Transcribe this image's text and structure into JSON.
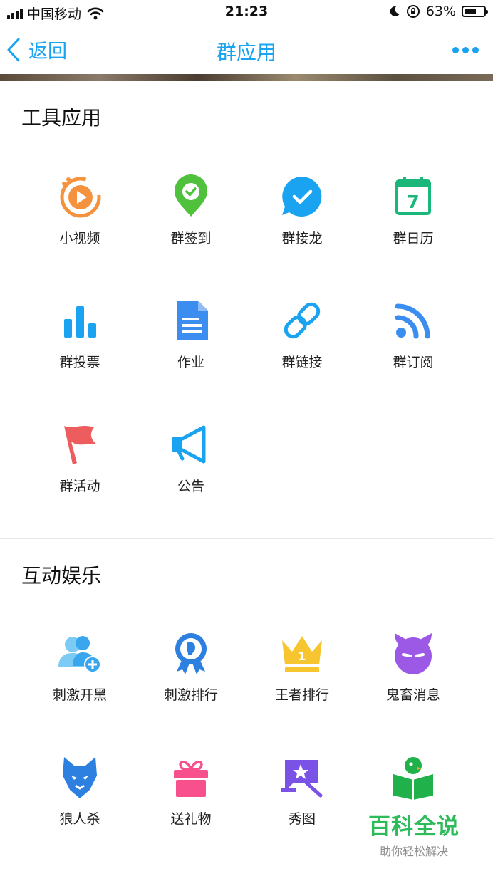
{
  "status_bar": {
    "carrier": "中国移动",
    "time": "21:23",
    "battery": "63%",
    "battery_level": 0.63
  },
  "nav": {
    "back_label": "返回",
    "title": "群应用"
  },
  "sections": [
    {
      "title": "工具应用",
      "apps": [
        {
          "label": "小视频",
          "icon": "video-icon"
        },
        {
          "label": "群签到",
          "icon": "checkin-pin-icon"
        },
        {
          "label": "群接龙",
          "icon": "chat-check-icon"
        },
        {
          "label": "群日历",
          "icon": "calendar-icon"
        },
        {
          "label": "群投票",
          "icon": "bar-chart-icon"
        },
        {
          "label": "作业",
          "icon": "document-icon"
        },
        {
          "label": "群链接",
          "icon": "link-icon"
        },
        {
          "label": "群订阅",
          "icon": "rss-icon"
        },
        {
          "label": "群活动",
          "icon": "flag-icon"
        },
        {
          "label": "公告",
          "icon": "megaphone-icon"
        }
      ]
    },
    {
      "title": "互动娱乐",
      "apps": [
        {
          "label": "刺激开黑",
          "icon": "team-add-icon"
        },
        {
          "label": "刺激排行",
          "icon": "medal-icon"
        },
        {
          "label": "王者排行",
          "icon": "crown-icon"
        },
        {
          "label": "鬼畜消息",
          "icon": "devil-icon"
        },
        {
          "label": "狼人杀",
          "icon": "wolf-icon"
        },
        {
          "label": "送礼物",
          "icon": "gift-icon"
        },
        {
          "label": "秀图",
          "icon": "magic-picture-icon"
        },
        {
          "label": "",
          "icon": "penguin-book-icon"
        }
      ]
    }
  ],
  "watermark": {
    "title": "百科全说",
    "subtitle": "助你轻松解决"
  },
  "colors": {
    "accent": "#1aa3f0",
    "watermark": "#2dbb5b"
  }
}
